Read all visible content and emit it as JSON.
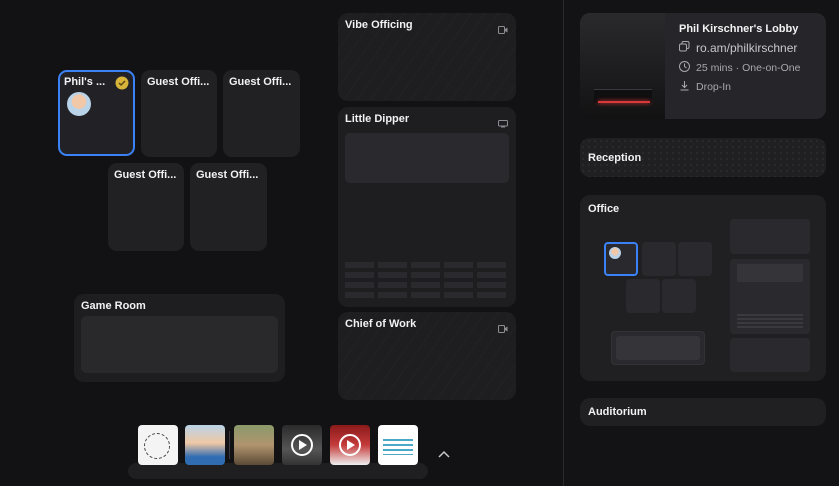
{
  "floor": {
    "desks": [
      {
        "label": "Phil's ...",
        "selected": true
      },
      {
        "label": "Guest Offi..."
      },
      {
        "label": "Guest Offi..."
      },
      {
        "label": "Guest Offi..."
      },
      {
        "label": "Guest Offi..."
      }
    ],
    "rooms": {
      "vibe": "Vibe Officing",
      "dipper": "Little Dipper",
      "chief": "Chief of Work",
      "game": "Game Room"
    }
  },
  "lobby": {
    "title": "Phil Kirschner's Lobby",
    "link": "ro.am/philkirschner",
    "meeting": "25 mins · One-on-One",
    "dropin": "Drop-In"
  },
  "sidebar": {
    "reception": "Reception",
    "office": "Office",
    "auditorium": "Auditorium"
  },
  "dock": {
    "play_icon": "play-icon",
    "expand_icon": "chevron-up-icon"
  },
  "colors": {
    "accent": "#3b82f6",
    "badge": "#d9b43a",
    "background": "#121214"
  }
}
